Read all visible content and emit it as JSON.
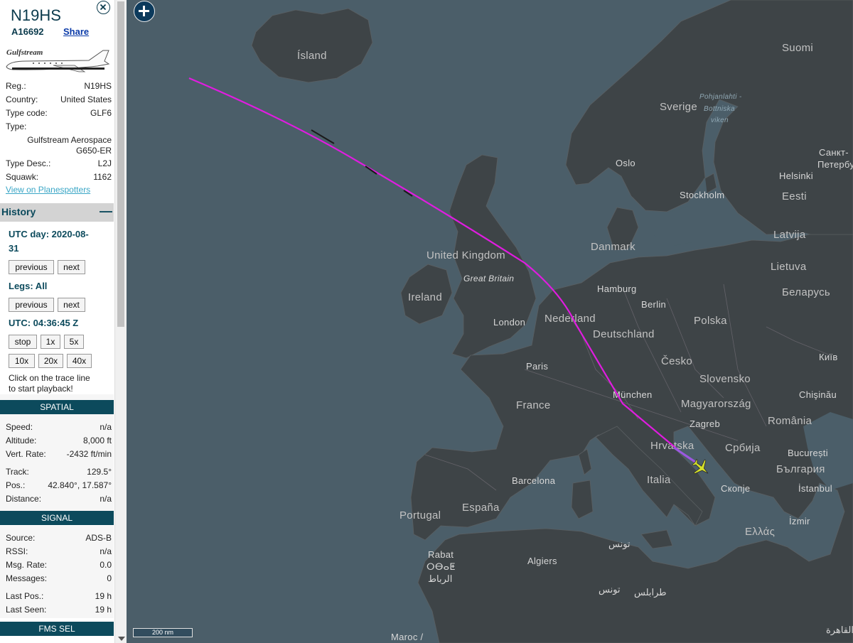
{
  "header": {
    "callsign": "N19HS",
    "hex": "A16692",
    "share_label": "Share"
  },
  "aircraft_image_brand": "Gulfstream",
  "details": {
    "reg": {
      "label": "Reg.:",
      "value": "N19HS"
    },
    "country": {
      "label": "Country:",
      "value": "United States"
    },
    "type_code": {
      "label": "Type code:",
      "value": "GLF6"
    },
    "type": {
      "label": "Type:",
      "value_line1": "Gulfstream Aerospace",
      "value_line2": "G650-ER"
    },
    "type_desc": {
      "label": "Type Desc.:",
      "value": "L2J"
    },
    "squawk": {
      "label": "Squawk:",
      "value": "1162"
    },
    "planespotters_link": "View on Planespotters"
  },
  "history": {
    "title": "History",
    "collapse_symbol": "—",
    "utc_day_line1": "UTC day: 2020-08-",
    "utc_day_line2": "31",
    "previous_label": "previous",
    "next_label": "next",
    "legs_label": "Legs: All",
    "utc_time": "UTC: 04:36:45 Z",
    "speed_buttons": [
      "stop",
      "1x",
      "5x",
      "10x",
      "20x",
      "40x"
    ],
    "hint_line1": "Click on the trace line",
    "hint_line2": "to start playback!"
  },
  "spatial": {
    "title": "SPATIAL",
    "speed": {
      "label": "Speed:",
      "value": "n/a"
    },
    "altitude": {
      "label": "Altitude:",
      "value": "8,000 ft"
    },
    "vert_rate": {
      "label": "Vert. Rate:",
      "value": "-2432 ft/min"
    },
    "track": {
      "label": "Track:",
      "value": "129.5°"
    },
    "pos": {
      "label": "Pos.:",
      "value": "42.840°, 17.587°"
    },
    "distance": {
      "label": "Distance:",
      "value": "n/a"
    }
  },
  "signal": {
    "title": "SIGNAL",
    "source": {
      "label": "Source:",
      "value": "ADS-B"
    },
    "rssi": {
      "label": "RSSI:",
      "value": "n/a"
    },
    "msg_rate": {
      "label": "Msg. Rate:",
      "value": "0.0"
    },
    "messages": {
      "label": "Messages:",
      "value": "0"
    },
    "last_pos": {
      "label": "Last Pos.:",
      "value": "19 h"
    },
    "last_seen": {
      "label": "Last Seen:",
      "value": "19 h"
    }
  },
  "fms": {
    "title": "FMS SEL"
  },
  "map": {
    "scale_label": "200 nm",
    "track_color": "#e01ce0",
    "aircraft_color": "#d4e02a",
    "labels": {
      "island": "Ísland",
      "sverige": "Sverige",
      "suomi": "Suomi",
      "pohjanlahti1": "Pohjanlahti -",
      "pohjanlahti2": "Bottniska",
      "pohjanlahti3": "viken",
      "oslo": "Oslo",
      "stockholm": "Stockholm",
      "helsinki": "Helsinki",
      "spb1": "Санкт-",
      "spb2": "Петербург",
      "eesti": "Eesti",
      "latvija": "Latvija",
      "lietuva": "Lietuva",
      "danmark": "Danmark",
      "uk": "United Kingdom",
      "great_britain": "Great Britain",
      "ireland": "Ireland",
      "london": "London",
      "nederland": "Nederland",
      "hamburg": "Hamburg",
      "berlin": "Berlin",
      "polska": "Polska",
      "belarus": "Беларусь",
      "deutschland": "Deutschland",
      "kyiv": "Київ",
      "cesko": "Česko",
      "paris": "Paris",
      "slovensko": "Slovensko",
      "munchen": "München",
      "chisinau": "Chişinău",
      "france": "France",
      "magyarorszag": "Magyarország",
      "zagreb": "Zagreb",
      "romania": "România",
      "hrvatska": "Hrvatska",
      "srbija": "Србија",
      "bucuresti": "București",
      "bulgaria": "България",
      "barcelona": "Barcelona",
      "italia": "Italia",
      "skopje": "Скопје",
      "istanbul": "İstanbul",
      "espana": "España",
      "portugal": "Portugal",
      "ellas": "Ελλάς",
      "izmir": "İzmir",
      "rabat": "Rabat",
      "rabat_tf": "ⵔⴱⴰⵟ",
      "rabat_ar": "الرباط",
      "tunis_ar": "تونس",
      "algiers": "Algiers",
      "tunis_ar2": "تونس",
      "tripoli_ar": "طرابلس",
      "maroc": "Maroc /",
      "cairo_ar": "القاهرة"
    }
  }
}
